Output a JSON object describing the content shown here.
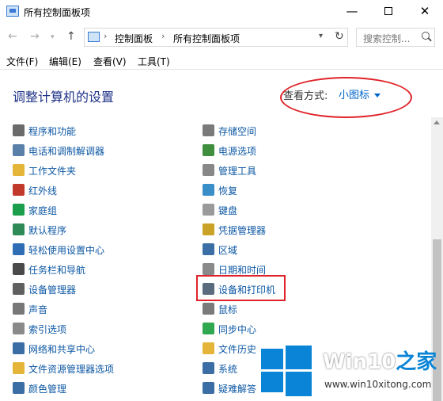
{
  "window": {
    "title": "所有控制面板项",
    "minimize_glyph": "—",
    "close_glyph": "✕"
  },
  "address": {
    "crumbs": [
      "控制面板",
      "所有控制面板项"
    ],
    "search_placeholder": "搜索控制..."
  },
  "menu": [
    "文件(F)",
    "编辑(E)",
    "查看(V)",
    "工具(T)"
  ],
  "main": {
    "heading": "调整计算机的设置",
    "view_by_label": "查看方式:",
    "view_by_value": "小图标"
  },
  "items_left": [
    {
      "label": "程序和功能",
      "icon": "programs-icon",
      "color": "#6b6b6b"
    },
    {
      "label": "电话和调制解调器",
      "icon": "phone-modem-icon",
      "color": "#5a7fa8"
    },
    {
      "label": "工作文件夹",
      "icon": "work-folders-icon",
      "color": "#e5b53a"
    },
    {
      "label": "红外线",
      "icon": "infrared-icon",
      "color": "#c0392b"
    },
    {
      "label": "家庭组",
      "icon": "homegroup-icon",
      "color": "#1a9e4b"
    },
    {
      "label": "默认程序",
      "icon": "default-programs-icon",
      "color": "#2e8b57"
    },
    {
      "label": "轻松使用设置中心",
      "icon": "ease-of-access-icon",
      "color": "#2f6db5"
    },
    {
      "label": "任务栏和导航",
      "icon": "taskbar-icon",
      "color": "#4a4a4a"
    },
    {
      "label": "设备管理器",
      "icon": "device-manager-icon",
      "color": "#606060"
    },
    {
      "label": "声音",
      "icon": "sound-icon",
      "color": "#777777"
    },
    {
      "label": "索引选项",
      "icon": "indexing-icon",
      "color": "#8a8a8a"
    },
    {
      "label": "网络和共享中心",
      "icon": "network-icon",
      "color": "#3a6ea5"
    },
    {
      "label": "文件资源管理器选项",
      "icon": "explorer-options-icon",
      "color": "#e5b53a"
    },
    {
      "label": "颜色管理",
      "icon": "color-management-icon",
      "color": "#3a6ea5"
    }
  ],
  "items_right": [
    {
      "label": "存储空间",
      "icon": "storage-spaces-icon",
      "color": "#7a7a7a"
    },
    {
      "label": "电源选项",
      "icon": "power-options-icon",
      "color": "#3f8f3f"
    },
    {
      "label": "管理工具",
      "icon": "admin-tools-icon",
      "color": "#888888"
    },
    {
      "label": "恢复",
      "icon": "recovery-icon",
      "color": "#3a8fc8"
    },
    {
      "label": "键盘",
      "icon": "keyboard-icon",
      "color": "#9a9a9a"
    },
    {
      "label": "凭据管理器",
      "icon": "credential-manager-icon",
      "color": "#c9a227"
    },
    {
      "label": "区域",
      "icon": "region-icon",
      "color": "#3a6ea5"
    },
    {
      "label": "日期和时间",
      "icon": "date-time-icon",
      "color": "#8a8a8a"
    },
    {
      "label": "设备和打印机",
      "icon": "devices-printers-icon",
      "color": "#5a6b7d"
    },
    {
      "label": "鼠标",
      "icon": "mouse-icon",
      "color": "#7a7a7a"
    },
    {
      "label": "同步中心",
      "icon": "sync-center-icon",
      "color": "#2fa84f"
    },
    {
      "label": "文件历史",
      "icon": "file-history-icon",
      "color": "#e5b53a"
    },
    {
      "label": "系统",
      "icon": "system-icon",
      "color": "#3a6ea5"
    },
    {
      "label": "疑难解答",
      "icon": "troubleshooting-icon",
      "color": "#3a6ea5"
    }
  ],
  "watermark": {
    "brand": "Win10",
    "brand_suffix": "之家",
    "url": "www.win10xitong.com"
  },
  "colors": {
    "link": "#0c57a3",
    "heading": "#1e3287",
    "annotation_red": "#e0232a",
    "win_blue": "#0a84d6"
  }
}
